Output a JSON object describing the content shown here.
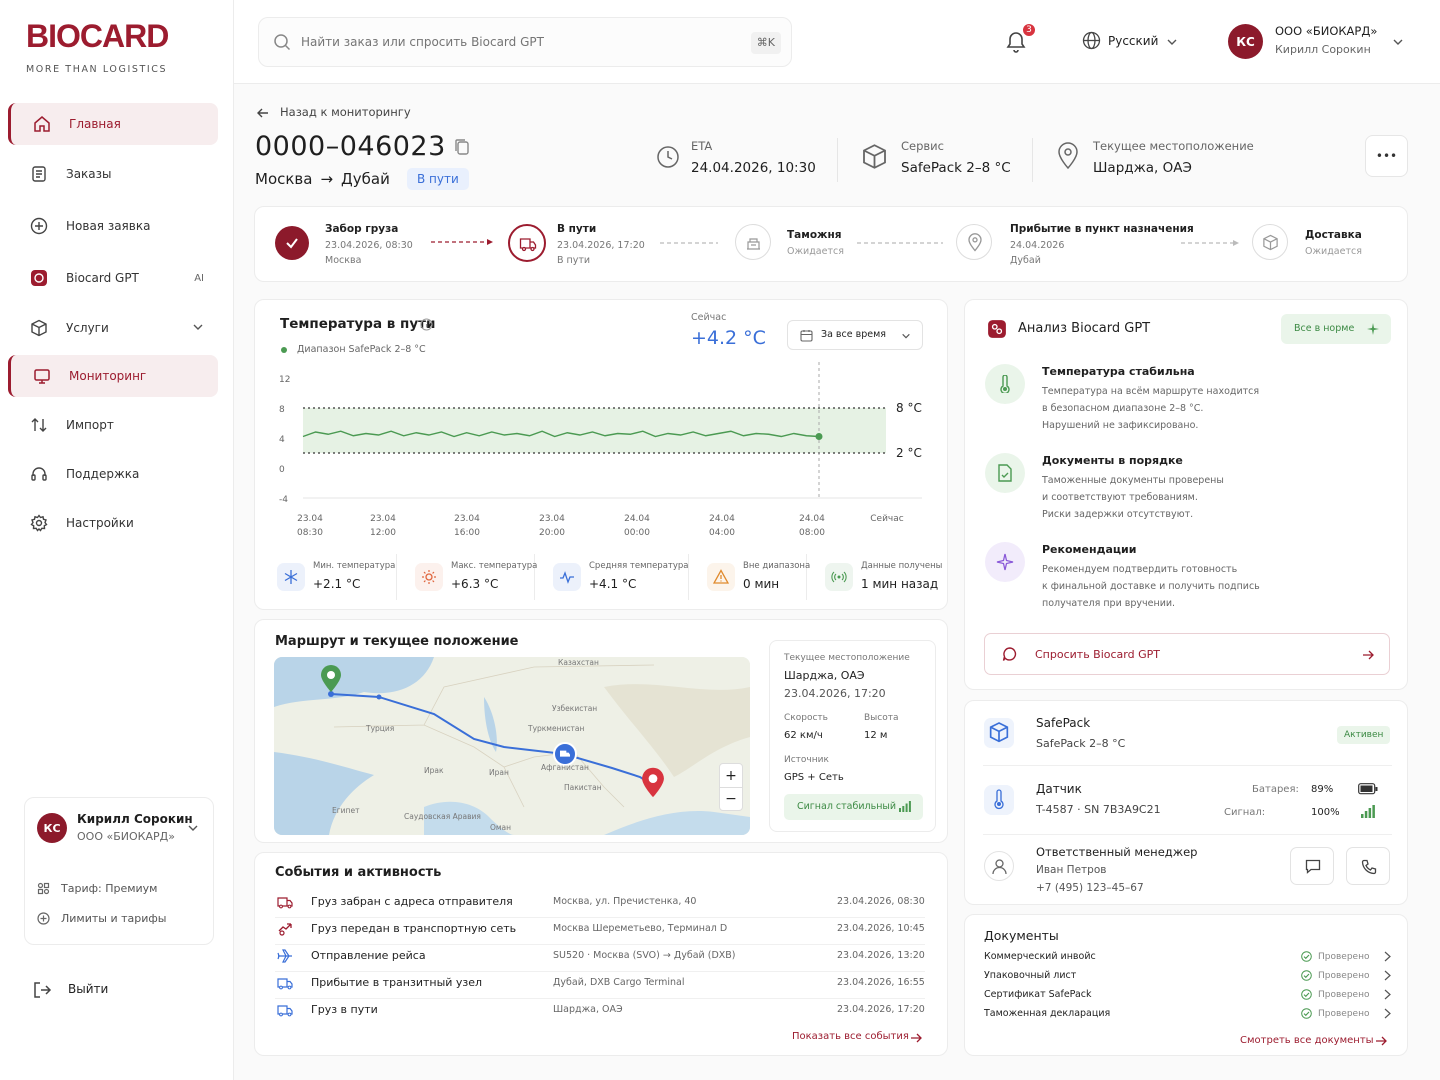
{
  "brand": {
    "name": "BIOCARD",
    "tagline": "MORE THAN LOGISTICS",
    "accent": "#9C1C2F"
  },
  "nav": [
    {
      "label": "Главная",
      "icon": "home-icon"
    },
    {
      "label": "Заказы",
      "icon": "orders-icon"
    },
    {
      "label": "Новая заявка",
      "icon": "plus-circle-icon"
    },
    {
      "label": "Biocard GPT",
      "icon": "gpt-icon",
      "tag": "AI"
    },
    {
      "label": "Услуги",
      "icon": "box-icon"
    },
    {
      "label": "Мониторинг",
      "icon": "monitor-icon"
    },
    {
      "label": "Импорт",
      "icon": "import-icon"
    },
    {
      "label": "Поддержка",
      "icon": "headset-icon"
    },
    {
      "label": "Настройки",
      "icon": "gear-icon"
    }
  ],
  "sidebar_user": {
    "initials": "КС",
    "name": "Кирилл Сорокин",
    "company": "ООО «БИОКАРД»",
    "tariff": "Тариф: Премиум",
    "limits": "Лимиты и тарифы",
    "logout": "Выйти"
  },
  "topbar": {
    "search_placeholder": "Найти заказ или спросить Biocard GPT",
    "shortcut": "⌘K",
    "notifications": "3",
    "language": "Русский",
    "company": "ООО «БИОКАРД»",
    "user": "Кирилл Сорокин",
    "initials": "КС"
  },
  "order": {
    "back": "Назад к мониторингу",
    "number": "0000–046023",
    "from": "Москва",
    "to": "Дубай",
    "arrow": "→",
    "status": "В пути",
    "eta_label": "ETA",
    "eta": "24.04.2026, 10:30",
    "service_label": "Сервис",
    "service": "SafePack 2–8 °C",
    "loc_label": "Текущее местоположение",
    "loc": "Шарджа, ОАЭ",
    "more": "•••"
  },
  "steps": [
    {
      "title": "Забор груза",
      "date": "23.04.2026, 08:30",
      "place": "Москва",
      "state": "done"
    },
    {
      "title": "В пути",
      "date": "23.04.2026, 17:20",
      "place": "В пути",
      "state": "current"
    },
    {
      "title": "Таможня",
      "date": "",
      "place": "Ожидается",
      "state": "pending"
    },
    {
      "title": "Прибытие в пункт назначения",
      "date": "24.04.2026",
      "place": "Дубай",
      "state": "pending"
    },
    {
      "title": "Доставка",
      "date": "",
      "place": "Ожидается",
      "state": "pending"
    }
  ],
  "temp": {
    "title": "Температура в пути",
    "range_label": "Диапазон SafePack 2–8 °C",
    "now_label": "Сейчас",
    "now": "+4.2 °C",
    "period": "За все время",
    "upper": "8 °C",
    "lower": "2 °C"
  },
  "chart_data": {
    "type": "line",
    "title": "Температура в пути",
    "ylim": [
      -4,
      12
    ],
    "yticks": [
      "12",
      "8",
      "4",
      "0",
      "-4"
    ],
    "band": [
      2,
      8
    ],
    "x": [
      "23.04 08:30",
      "23.04 12:00",
      "23.04 16:00",
      "23.04 20:00",
      "24.04 00:00",
      "24.04 04:00",
      "24.04 08:00",
      "Сейчас"
    ],
    "xticks": [
      {
        "d": "23.04",
        "t": "08:30"
      },
      {
        "d": "23.04",
        "t": "12:00"
      },
      {
        "d": "23.04",
        "t": "16:00"
      },
      {
        "d": "23.04",
        "t": "20:00"
      },
      {
        "d": "24.04",
        "t": "00:00"
      },
      {
        "d": "24.04",
        "t": "04:00"
      },
      {
        "d": "24.04",
        "t": "08:00"
      },
      {
        "d": "Сейчас",
        "t": ""
      }
    ],
    "series": [
      {
        "values": [
          4.2,
          4.8,
          4.5,
          4.9,
          4.3,
          4.6,
          4.4,
          4.9,
          4.3,
          4.7,
          4.4,
          4.8,
          4.2,
          4.7,
          4.3,
          4.8,
          4.4,
          4.6,
          4.3,
          4.9,
          4.2,
          4.7,
          4.4,
          4.8,
          4.3,
          4.6,
          4.5,
          4.9,
          4.2,
          4.6,
          4.4,
          4.8,
          4.3,
          4.6,
          4.9,
          4.3,
          4.6,
          4.5,
          4.2,
          4.6,
          4.3,
          4.2
        ]
      }
    ]
  },
  "temp_stats": [
    {
      "label": "Мин. температура",
      "value": "+2.1 °C",
      "icon": "snowflake-icon",
      "color": "#3a6fd8"
    },
    {
      "label": "Макс. температура",
      "value": "+6.3 °C",
      "icon": "sun-icon",
      "color": "#e0653d"
    },
    {
      "label": "Средняя температура",
      "value": "+4.1 °C",
      "icon": "pulse-icon",
      "color": "#3a6fd8"
    },
    {
      "label": "Вне диапазона",
      "value": "0 мин",
      "icon": "warning-icon",
      "color": "#e08a2d"
    },
    {
      "label": "Данные получены",
      "value": "1 мин назад",
      "icon": "signal-icon",
      "color": "#4b9a52"
    }
  ],
  "route": {
    "title": "Маршрут и текущее положение",
    "loc_label": "Текущее местоположение",
    "loc": "Шарджа, ОАЭ",
    "time": "23.04.2026, 17:20",
    "speed_label": "Скорость",
    "speed": "62 км/ч",
    "alt_label": "Высота",
    "alt": "12 м",
    "source_label": "Источник",
    "source": "GPS + Сеть",
    "signal": "Сигнал стабильный",
    "map_labels": [
      "Казахстан",
      "Узбекистан",
      "Туркменистан",
      "Турция",
      "Ирак",
      "Иран",
      "Афганистан",
      "Пакистан",
      "Египет",
      "Саудовская Аравия",
      "Оман"
    ]
  },
  "events": {
    "title": "События и активность",
    "more": "Показать все события",
    "rows": [
      {
        "icon": "truck-icon",
        "title": "Груз забран с адреса отправителя",
        "place": "Москва, ул. Пречистенка, 40",
        "time": "23.04.2026, 08:30"
      },
      {
        "icon": "handover-icon",
        "title": "Груз передан в транспортную сеть",
        "place": "Москва Шереметьево, Терминал D",
        "time": "23.04.2026, 10:45"
      },
      {
        "icon": "plane-icon",
        "title": "Отправление рейса",
        "place": "SU520 · Москва (SVO) → Дубай (DXB)",
        "time": "23.04.2026, 13:20"
      },
      {
        "icon": "truck-icon",
        "title": "Прибытие в транзитный узел",
        "place": "Дубай, DXB Cargo Terminal",
        "time": "23.04.2026, 16:55"
      },
      {
        "icon": "truck-icon",
        "title": "Груз в пути",
        "place": "Шарджа, ОАЭ",
        "time": "23.04.2026, 17:20"
      }
    ]
  },
  "gpt": {
    "title": "Анализ Biocard GPT",
    "badge": "Все в норме",
    "ask": "Спросить Biocard GPT",
    "items": [
      {
        "icon": "thermometer-icon",
        "title": "Температура стабильна",
        "lines": [
          "Температура на всём маршруте находится",
          "в безопасном диапазоне 2–8 °C.",
          "Нарушений не зафиксировано."
        ]
      },
      {
        "icon": "document-check-icon",
        "title": "Документы в порядке",
        "lines": [
          "Таможенные документы проверены",
          "и соответствуют требованиям.",
          "Риски задержки отсутствуют."
        ]
      },
      {
        "icon": "sparkle-icon",
        "title": "Рекомендации",
        "lines": [
          "Рекомендуем подтвердить готовность",
          "к финальной доставке и получить подпись",
          "получателя при вручении."
        ]
      }
    ]
  },
  "device": {
    "name": "SafePack",
    "sub": "SafePack 2–8 °C",
    "status": "Активен",
    "sensor_label": "Датчик",
    "sensor": "T-4587 · SN 7B3A9C21",
    "battery_label": "Батарея:",
    "battery": "89%",
    "signal_label": "Сигнал:",
    "signal": "100%",
    "manager_label": "Ответственный менеджер",
    "manager": "Иван Петров",
    "phone": "+7 (495) 123–45–67"
  },
  "documents": {
    "title": "Документы",
    "more": "Смотреть все документы",
    "rows": [
      {
        "name": "Коммерческий инвойс",
        "status": "Проверено"
      },
      {
        "name": "Упаковочный лист",
        "status": "Проверено"
      },
      {
        "name": "Сертификат SafePack",
        "status": "Проверено"
      },
      {
        "name": "Таможенная декларация",
        "status": "Проверено"
      }
    ]
  }
}
